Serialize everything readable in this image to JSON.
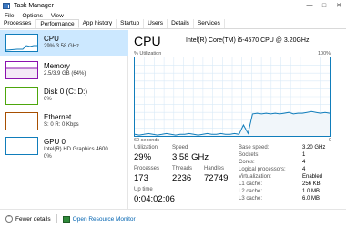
{
  "window": {
    "title": "Task Manager"
  },
  "menu": [
    "File",
    "Options",
    "View"
  ],
  "tabs": [
    "Processes",
    "Performance",
    "App history",
    "Startup",
    "Users",
    "Details",
    "Services"
  ],
  "active_tab": "Performance",
  "sidebar": [
    {
      "title": "CPU",
      "sub": "29% 3.58 GHz",
      "selected": true
    },
    {
      "title": "Memory",
      "sub": "2.5/3.9 GB (64%)"
    },
    {
      "title": "Disk 0 (C: D:)",
      "sub": "0%"
    },
    {
      "title": "Ethernet",
      "sub": "S: 0 R: 0 Kbps"
    },
    {
      "title": "GPU 0",
      "sub": "Intel(R) HD Graphics 4600",
      "sub2": "0%"
    }
  ],
  "main": {
    "title": "CPU",
    "model": "Intel(R) Core(TM) i5-4570 CPU @ 3.20GHz",
    "graph_label": "% Utilization",
    "graph_max": "100%",
    "graph_time": "60 seconds",
    "graph_min": "0",
    "utilization_label": "Utilization",
    "utilization": "29%",
    "speed_label": "Speed",
    "speed": "3.58 GHz",
    "processes_label": "Processes",
    "processes": "173",
    "threads_label": "Threads",
    "threads": "2236",
    "handles_label": "Handles",
    "handles": "72749",
    "uptime_label": "Up time",
    "uptime": "0:04:02:06",
    "specs": [
      {
        "k": "Base speed:",
        "v": "3.20 GHz"
      },
      {
        "k": "Sockets:",
        "v": "1"
      },
      {
        "k": "Cores:",
        "v": "4"
      },
      {
        "k": "Logical processors:",
        "v": "4"
      },
      {
        "k": "Virtualization:",
        "v": "Enabled"
      },
      {
        "k": "L1 cache:",
        "v": "256 KB"
      },
      {
        "k": "L2 cache:",
        "v": "1.0 MB"
      },
      {
        "k": "L3 cache:",
        "v": "6.0 MB"
      }
    ]
  },
  "footer": {
    "fewer_details": "Fewer details",
    "open_rm": "Open Resource Monitor"
  },
  "colors": {
    "accent": "#117dbb",
    "selected": "#cce8ff",
    "memory": "#8b12ae",
    "disk": "#4da60c",
    "ethernet": "#a74f01"
  },
  "chart_data": {
    "type": "area",
    "ylabel": "% Utilization",
    "ylim": [
      0,
      100
    ],
    "y": [
      2,
      1,
      2,
      3,
      2,
      1,
      2,
      3,
      2,
      1,
      2,
      2,
      3,
      2,
      1,
      2,
      3,
      2,
      2,
      3,
      2,
      2,
      3,
      2,
      14,
      3,
      28,
      29,
      28,
      29,
      28,
      29,
      28,
      29,
      30,
      28,
      29,
      29,
      30,
      31,
      30,
      29,
      30,
      29
    ]
  }
}
